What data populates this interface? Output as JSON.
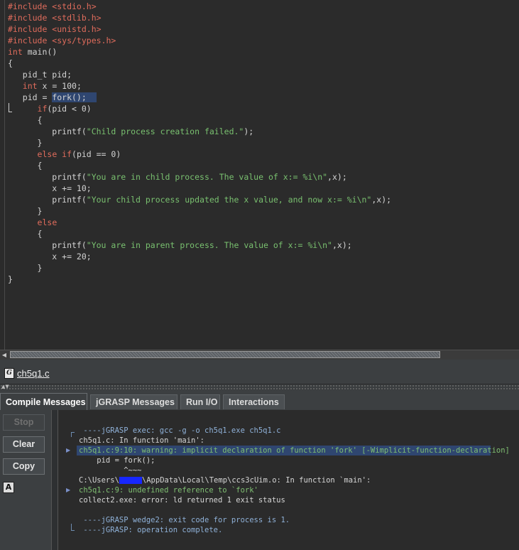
{
  "editor": {
    "lines": [
      [
        {
          "t": "#include <stdio.h>",
          "c": "kw"
        }
      ],
      [
        {
          "t": "#include <stdlib.h>",
          "c": "kw"
        }
      ],
      [
        {
          "t": "#include <unistd.h>",
          "c": "kw"
        }
      ],
      [
        {
          "t": "#include <sys/types.h>",
          "c": "kw"
        }
      ],
      [
        {
          "t": "int",
          "c": "kw"
        },
        {
          "t": " main()"
        }
      ],
      [
        {
          "t": "{"
        }
      ],
      [
        {
          "t": "   pid_t pid;"
        }
      ],
      [
        {
          "t": "   "
        },
        {
          "t": "int",
          "c": "kw"
        },
        {
          "t": " x = 100;"
        }
      ],
      [
        {
          "t": "   pid = "
        },
        {
          "t": "fork();  ",
          "c": "sel"
        }
      ],
      [
        {
          "t": "      "
        },
        {
          "t": "if",
          "c": "kw"
        },
        {
          "t": "(pid < 0)"
        }
      ],
      [
        {
          "t": "      {"
        }
      ],
      [
        {
          "t": "         printf("
        },
        {
          "t": "\"Child process creation failed.\"",
          "c": "str"
        },
        {
          "t": ");"
        }
      ],
      [
        {
          "t": "      }"
        }
      ],
      [
        {
          "t": "      "
        },
        {
          "t": "else if",
          "c": "kw"
        },
        {
          "t": "(pid == 0)"
        }
      ],
      [
        {
          "t": "      {"
        }
      ],
      [
        {
          "t": "         printf("
        },
        {
          "t": "\"You are in child process. The value of x:= %i\\n\"",
          "c": "str"
        },
        {
          "t": ",x);"
        }
      ],
      [
        {
          "t": "         x += 10;"
        }
      ],
      [
        {
          "t": "         printf("
        },
        {
          "t": "\"Your child process updated the x value, and now x:= %i\\n\"",
          "c": "str"
        },
        {
          "t": ",x);"
        }
      ],
      [
        {
          "t": "      }"
        }
      ],
      [
        {
          "t": "      "
        },
        {
          "t": "else",
          "c": "kw"
        }
      ],
      [
        {
          "t": "      {"
        }
      ],
      [
        {
          "t": "         printf("
        },
        {
          "t": "\"You are in parent process. The value of x:= %i\\n\"",
          "c": "str"
        },
        {
          "t": ",x);"
        }
      ],
      [
        {
          "t": "         x += 20;"
        }
      ],
      [
        {
          "t": "      }"
        }
      ],
      [
        {
          "t": "}"
        }
      ]
    ]
  },
  "file_tab": {
    "icon": "G",
    "name": "ch5q1.c"
  },
  "message_tabs": [
    {
      "label": "Compile Messages",
      "active": true
    },
    {
      "label": "jGRASP Messages",
      "active": false
    },
    {
      "label": "Run I/O",
      "active": false
    },
    {
      "label": "Interactions",
      "active": false
    }
  ],
  "buttons": {
    "stop": "Stop",
    "clear": "Clear",
    "copy": "Copy",
    "font_icon": "A"
  },
  "messages": {
    "line1": " ----jGRASP exec: gcc -g -o ch5q1.exe ch5q1.c",
    "line2": "ch5q1.c: In function 'main':",
    "line3": "ch5q1.c:9:10: warning: implicit declaration of function 'fork' [-Wimplicit-function-declaration]",
    "line4": "    pid = fork();",
    "line5": "          ^~~~",
    "line6a": "C:\\Users\\",
    "line6b": "\\AppData\\Local\\Temp\\ccs3cUim.o: In function `main':",
    "line7": "ch5q1.c:9: undefined reference to `fork'",
    "line8": "collect2.exe: error: ld returned 1 exit status",
    "line9": " ----jGRASP wedge2: exit code for process is 1.",
    "line10": " ----jGRASP: operation complete."
  },
  "colors": {
    "keyword": "#e06c5c",
    "string": "#79c06f",
    "selection": "#2f4670",
    "redaction": "#1727ff"
  }
}
